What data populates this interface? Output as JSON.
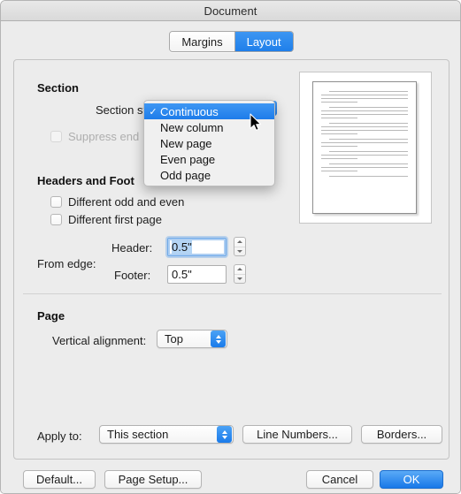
{
  "window": {
    "title": "Document"
  },
  "tabs": [
    {
      "label": "Margins",
      "active": false
    },
    {
      "label": "Layout",
      "active": true
    }
  ],
  "section": {
    "group_title": "Section",
    "section_start_label": "Section start:",
    "section_start_value": "Continuous",
    "suppress_endnotes_label": "Suppress end",
    "suppress_endnotes_checked": false,
    "suppress_endnotes_disabled": true
  },
  "section_start_menu": {
    "open": true,
    "check_glyph": "✓",
    "items": [
      {
        "label": "Continuous",
        "selected": true,
        "checked": true
      },
      {
        "label": "New column",
        "selected": false,
        "checked": false
      },
      {
        "label": "New page",
        "selected": false,
        "checked": false
      },
      {
        "label": "Even page",
        "selected": false,
        "checked": false
      },
      {
        "label": "Odd page",
        "selected": false,
        "checked": false
      }
    ]
  },
  "headers_footers": {
    "group_title": "Headers and Foot",
    "different_odd_even_label": "Different odd and even",
    "different_odd_even_checked": false,
    "different_first_page_label": "Different first page",
    "different_first_page_checked": false,
    "from_edge_label": "From edge:",
    "header_label": "Header:",
    "header_value": "0.5\"",
    "header_focused": true,
    "footer_label": "Footer:",
    "footer_value": "0.5\"",
    "footer_focused": false
  },
  "page": {
    "group_title": "Page",
    "vertical_alignment_label": "Vertical alignment:",
    "vertical_alignment_value": "Top"
  },
  "apply": {
    "apply_to_label": "Apply to:",
    "apply_to_value": "This section",
    "line_numbers_label": "Line Numbers...",
    "borders_label": "Borders..."
  },
  "footer_buttons": {
    "default_label": "Default...",
    "page_setup_label": "Page Setup...",
    "cancel_label": "Cancel",
    "ok_label": "OK"
  },
  "colors": {
    "accent_blue": "#1d7cea",
    "selection_blue": "#b4d5f5",
    "window_bg": "#ececec"
  },
  "preview": {
    "paragraph_count": 6
  }
}
